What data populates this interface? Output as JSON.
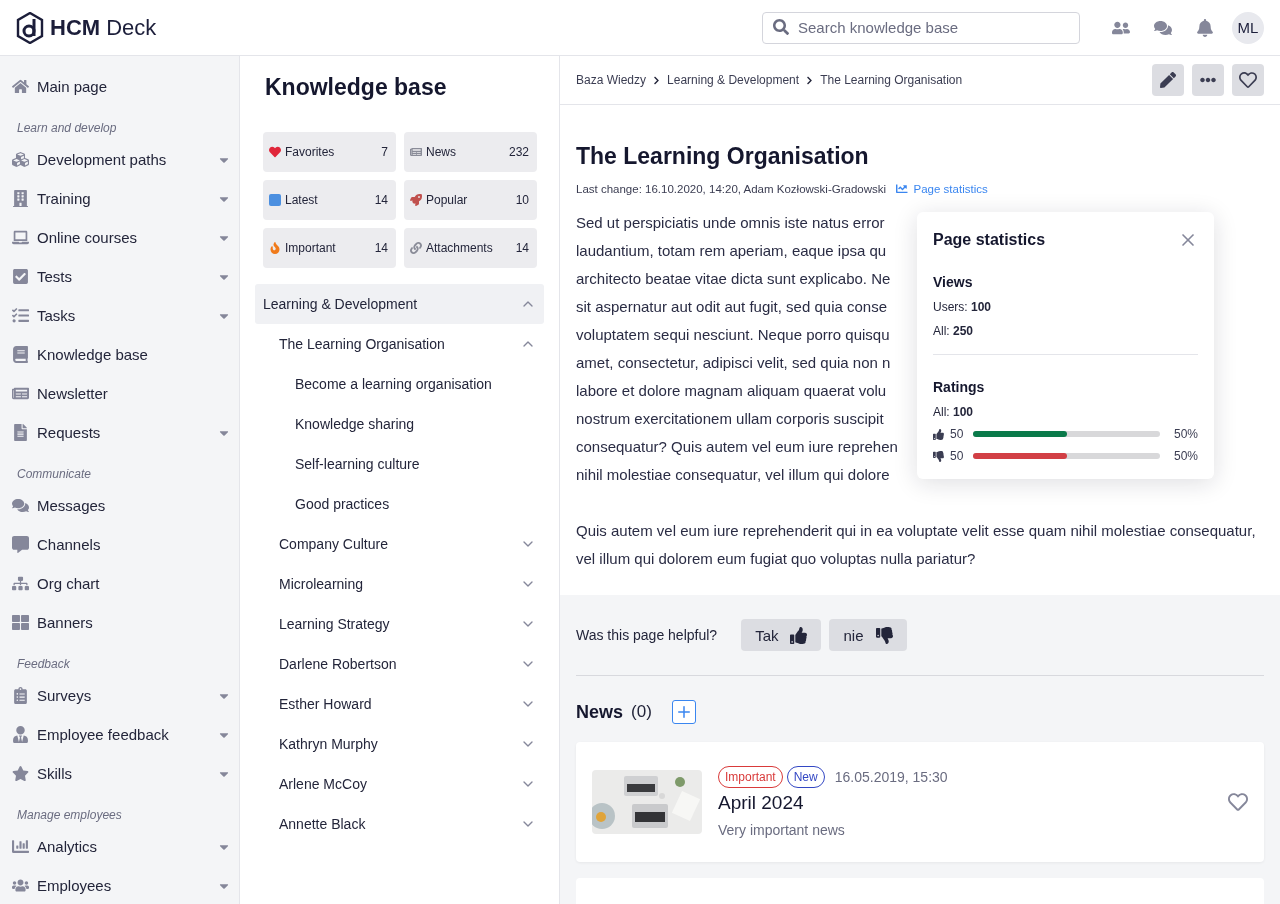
{
  "header": {
    "logo": "**HCM** Deck",
    "search": {
      "placeholder": "Search knowledge base"
    },
    "avatar": "ML"
  },
  "sidebar": {
    "groups": [
      {
        "items": [
          {
            "label": "Main page",
            "kind": "link"
          }
        ]
      },
      {
        "heading": "Learn and develop",
        "items": [
          {
            "label": "Development paths",
            "kind": "menu"
          },
          {
            "label": "Training",
            "kind": "menu"
          },
          {
            "label": "Online courses",
            "kind": "menu"
          },
          {
            "label": "Tests",
            "kind": "menu"
          },
          {
            "label": "Tasks",
            "kind": "menu"
          },
          {
            "label": "Knowledge base",
            "kind": "link"
          },
          {
            "label": "Newsletter",
            "kind": "link"
          },
          {
            "label": "Requests",
            "kind": "menu"
          }
        ]
      },
      {
        "heading": "Communicate",
        "items": [
          {
            "label": "Messages",
            "kind": "link"
          },
          {
            "label": "Channels",
            "kind": "link"
          },
          {
            "label": "Org chart",
            "kind": "link"
          },
          {
            "label": "Banners",
            "kind": "link"
          }
        ]
      },
      {
        "heading": "Feedback",
        "items": [
          {
            "label": "Surveys",
            "kind": "menu"
          },
          {
            "label": "Employee feedback",
            "kind": "menu"
          },
          {
            "label": "Skills",
            "kind": "menu"
          }
        ]
      },
      {
        "heading": "Manage employees",
        "items": [
          {
            "label": "Analytics",
            "kind": "menu"
          },
          {
            "label": "Employees",
            "kind": "menu"
          }
        ]
      }
    ]
  },
  "knowledge_base": {
    "title": "Knowledge base",
    "tiles": [
      {
        "label": "Favorites",
        "count": "7"
      },
      {
        "label": "News",
        "count": "232"
      },
      {
        "label": "Latest",
        "count": "14"
      },
      {
        "label": "Popular",
        "count": "10"
      },
      {
        "label": "Important",
        "count": "14"
      },
      {
        "label": "Attachments",
        "count": "14"
      }
    ],
    "tree": [
      {
        "label": "Learning & Development",
        "kind": "folder",
        "expanded": true,
        "selected": true,
        "children": [
          {
            "label": "The Learning Organisation",
            "kind": "folder",
            "expanded": true,
            "selected": false,
            "children": [
              {
                "label": "Become a learning organisation",
                "kind": "page",
                "selected": false
              },
              {
                "label": "Knowledge sharing",
                "kind": "page",
                "selected": false
              },
              {
                "label": "Self-learning culture",
                "kind": "page",
                "selected": false
              },
              {
                "label": "Good practices",
                "kind": "page",
                "selected": false
              }
            ]
          },
          {
            "label": "Company Culture",
            "kind": "folder",
            "expanded": false,
            "selected": false
          },
          {
            "label": "Microlearning",
            "kind": "folder",
            "expanded": false,
            "selected": false
          },
          {
            "label": "Learning Strategy",
            "kind": "folder",
            "expanded": false,
            "selected": false
          },
          {
            "label": "Darlene Robertson",
            "kind": "folder",
            "expanded": false,
            "selected": false
          },
          {
            "label": "Esther Howard",
            "kind": "folder",
            "expanded": false,
            "selected": false
          },
          {
            "label": "Kathryn Murphy",
            "kind": "folder",
            "expanded": false,
            "selected": false
          },
          {
            "label": "Arlene McCoy",
            "kind": "folder",
            "expanded": false,
            "selected": false
          },
          {
            "label": "Annette Black",
            "kind": "folder",
            "expanded": false,
            "selected": false
          }
        ]
      }
    ]
  },
  "article": {
    "breadcrumb": [
      "Baza Wiedzy",
      "Learning & Development",
      "The Learning Organisation"
    ],
    "title": "The Learning Organisation",
    "meta": "Last change: 16.10.2020, 14:20, Adam Kozłowski-Gradowski",
    "stats_link": "Page statistics",
    "paragraph_1_lines": [
      "Sed ut perspiciatis unde omnis iste natus error",
      "laudantium, totam rem aperiam, eaque ipsa qu",
      "architecto beatae vitae dicta sunt explicabo. Ne",
      "sit aspernatur aut odit aut fugit, sed quia conse",
      "voluptatem sequi nesciunt. Neque porro quisqu",
      "amet, consectetur, adipisci velit, sed quia non n",
      "labore et dolore magnam aliquam quaerat volu",
      "nostrum exercitationem ullam corporis suscipit",
      "consequatur? Quis autem vel eum iure reprehen",
      "nihil molestiae consequatur, vel illum qui dolore"
    ],
    "paragraph_2": "Quis autem vel eum iure reprehenderit qui in ea voluptate velit esse quam nihil molestiae consequatur, vel illum qui dolorem eum fugiat quo voluptas nulla pariatur?"
  },
  "statistics_popover": {
    "title": "Page statistics",
    "views_heading": "Views",
    "views": [
      "Users: **100**",
      "All: **250**"
    ],
    "ratings_heading": "Ratings",
    "ratings_total": "All: **100**",
    "ratings": [
      {
        "kind": "up",
        "count": "50",
        "level": 0.5,
        "color": "#0a7a4a",
        "percent": "50%"
      },
      {
        "kind": "down",
        "count": "50",
        "level": 0.5,
        "color": "#d23f45",
        "percent": "50%"
      }
    ]
  },
  "helpful": {
    "question": "Was this page helpful?",
    "buttons": [
      {
        "label": "Tak",
        "kind": "up"
      },
      {
        "label": "nie",
        "kind": "down"
      }
    ]
  },
  "news": {
    "title": "News",
    "count": "(0)",
    "items": [
      {
        "tags": [
          {
            "label": "Important",
            "color": "#d93a3a"
          },
          {
            "label": "New",
            "color": "#3347c4"
          }
        ],
        "date": "16.05.2019, 15:30",
        "title": "April 2024",
        "subtitle": "Very important news"
      }
    ]
  }
}
